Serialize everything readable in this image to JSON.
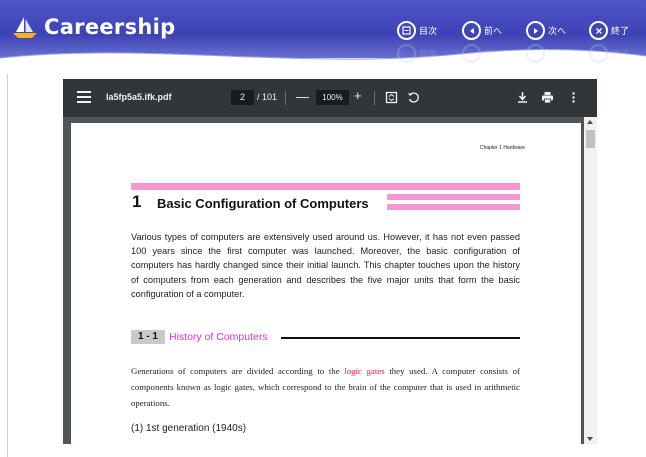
{
  "brand": {
    "name": "Careership"
  },
  "nav": [
    {
      "id": "contents",
      "label": "目次",
      "icon": "list-icon"
    },
    {
      "id": "prev",
      "label": "前へ",
      "icon": "arrow-left-icon"
    },
    {
      "id": "next",
      "label": "次へ",
      "icon": "arrow-right-icon"
    },
    {
      "id": "exit",
      "label": "終了",
      "icon": "close-icon"
    }
  ],
  "viewer": {
    "file_name": "la5fp5a5.ifk.pdf",
    "current_page": "2",
    "total_pages": "/ 101",
    "zoom": "100%",
    "minus": "—",
    "plus": "+"
  },
  "document": {
    "chapter_header": "Chapter 1 Hardware",
    "section_number": "1",
    "section_title": "Basic Configuration of Computers",
    "intro": "Various types of computers are extensively used around us. However, it has not even passed 100 years since the first computer was launched. Moreover, the basic configuration of computers has hardly changed since their initial launch. This chapter touches upon the history of computers from each generation and describes the five major units that form the basic configuration of a computer.",
    "subsection_number": "1 - 1",
    "subsection_title": "History of Computers",
    "para_before": "Generations of computers are divided according to the ",
    "para_highlight": "logic gates",
    "para_after": " they used. A computer consists of components known as logic gates, which correspond to the brain of the computer that is used in arithmetic operations.",
    "generation_item": "(1)  1st generation (1940s)"
  },
  "colors": {
    "banner": "#4e55c9",
    "toolbar": "#323639",
    "viewer_bg": "#525659",
    "accent_pink": "#f497d2",
    "subsection_magenta": "#e62ed6",
    "highlight_red": "#e0203a"
  }
}
